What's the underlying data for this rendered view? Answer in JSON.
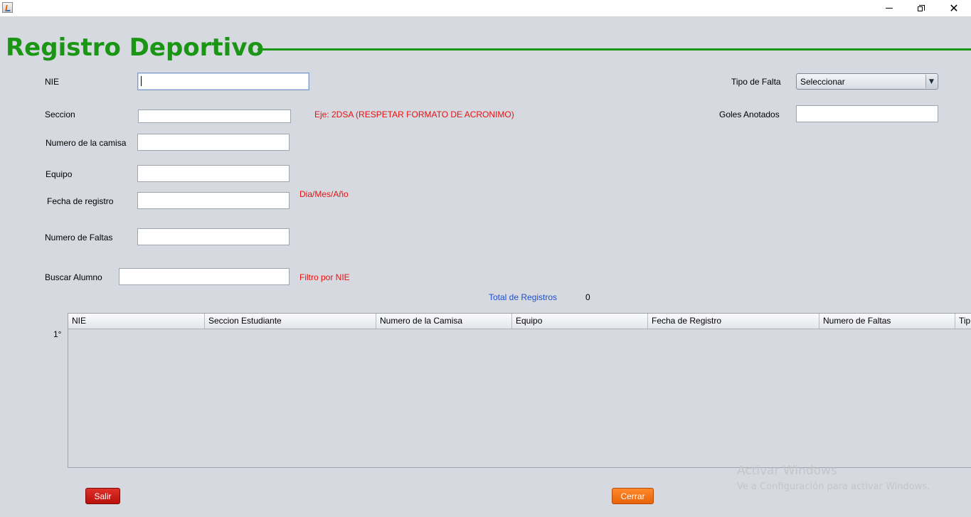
{
  "window": {
    "minimize_glyph": "",
    "close_glyph": "✕"
  },
  "header": {
    "title": "Registro Deportivo"
  },
  "form": {
    "nie_label": "NIE",
    "nie_value": "",
    "seccion_label": "Seccion",
    "seccion_value": "",
    "seccion_hint": "Eje: 2DSA (RESPETAR FORMATO DE ACRONIMO)",
    "camisa_label": "Numero de la camisa",
    "camisa_value": "",
    "equipo_label": "Equipo",
    "equipo_value": "",
    "fecha_label": "Fecha de registro",
    "fecha_value": "",
    "fecha_hint": "Dia/Mes/Año",
    "faltas_label": "Numero de Faltas",
    "faltas_value": "",
    "buscar_label": "Buscar Alumno",
    "buscar_value": "",
    "buscar_hint": "Filtro por NIE",
    "tipo_falta_label": "Tipo de Falta",
    "tipo_falta_selected": "Seleccionar",
    "goles_label": "Goles Anotados",
    "goles_value": ""
  },
  "totals": {
    "label": "Total de Registros",
    "value": "0"
  },
  "table": {
    "columns": [
      "NIE",
      "Seccion Estudiante",
      "Numero de la Camisa",
      "Equipo",
      "Fecha de Registro",
      "Numero de Faltas",
      "Tip"
    ],
    "row_number": "1°",
    "rows": []
  },
  "buttons": {
    "salir": "Salir",
    "cerrar": "Cerrar"
  },
  "watermark": {
    "line1": "Activar Windows",
    "line2": "Ve a Configuración para activar Windows."
  },
  "colors": {
    "title_green": "#1a9614",
    "hint_red": "#e51212",
    "total_blue": "#1f4fcf",
    "salir_red": "#c8140f",
    "cerrar_orange": "#f2700f",
    "background": "#d6d9e0"
  },
  "icons": [
    "java-app-icon",
    "minimize-icon",
    "restore-icon",
    "close-icon",
    "dropdown-arrow-icon"
  ]
}
